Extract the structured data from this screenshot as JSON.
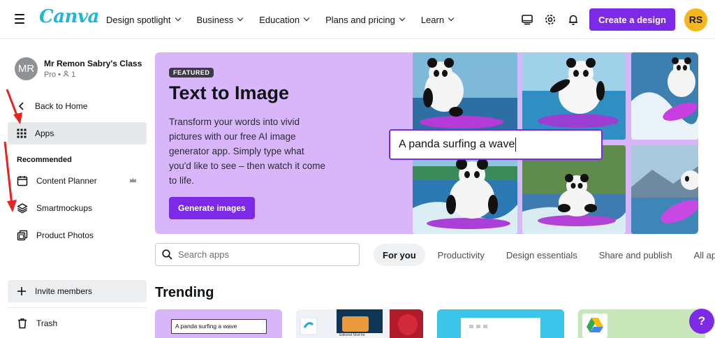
{
  "header": {
    "logo": "Canva",
    "nav": [
      {
        "label": "Design spotlight"
      },
      {
        "label": "Business"
      },
      {
        "label": "Education"
      },
      {
        "label": "Plans and pricing"
      },
      {
        "label": "Learn"
      }
    ],
    "create_label": "Create a design",
    "avatar_initials": "RS",
    "icons": [
      "monitor-icon",
      "gear-icon",
      "bell-icon"
    ],
    "accent": "#7d2ae8",
    "avatar_color": "#f5b71b"
  },
  "sidebar": {
    "team_initials": "MR",
    "team_name": "Mr Remon Sabry's Class",
    "team_plan": "Pro",
    "team_members": "1",
    "back_label": "Back to Home",
    "apps_label": "Apps",
    "recommended_label": "Recommended",
    "items": [
      {
        "label": "Content Planner",
        "icon": "calendar-icon"
      },
      {
        "label": "Smartmockups",
        "icon": "layers-icon"
      },
      {
        "label": "Product Photos",
        "icon": "photos-icon"
      }
    ],
    "invite_label": "Invite members",
    "trash_label": "Trash"
  },
  "banner": {
    "badge": "FEATURED",
    "title": "Text to Image",
    "description": "Transform your words into vivid pictures with our free AI image generator app. Simply type what you'd like to see – then watch it come to life.",
    "button": "Generate images",
    "prompt": "A panda surfing a wave",
    "background": "#d8b6f9"
  },
  "search": {
    "placeholder": "Search apps"
  },
  "tabs": [
    {
      "label": "For you",
      "active": true
    },
    {
      "label": "Productivity"
    },
    {
      "label": "Design essentials"
    },
    {
      "label": "Share and publish"
    },
    {
      "label": "All ap"
    }
  ],
  "trending": {
    "title": "Trending",
    "card1_prompt": "A panda surfing a wave",
    "card2_caption": "Editorial Shot for"
  },
  "help_label": "?"
}
